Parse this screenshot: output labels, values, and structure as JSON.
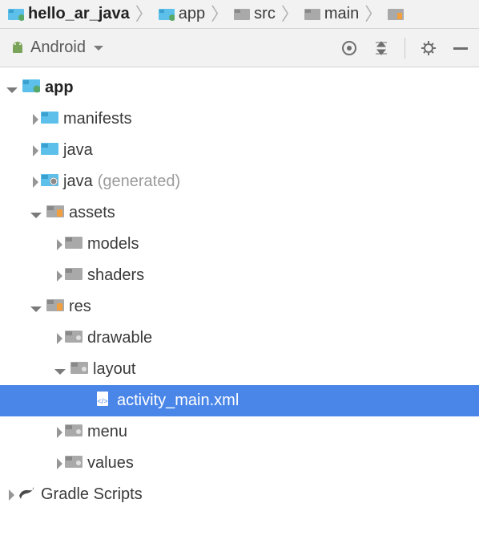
{
  "breadcrumb": {
    "items": [
      {
        "label": "hello_ar_java"
      },
      {
        "label": "app"
      },
      {
        "label": "src"
      },
      {
        "label": "main"
      }
    ]
  },
  "toolbar": {
    "view_label": "Android"
  },
  "tree": {
    "items": [
      {
        "label": "app",
        "depth": 0,
        "arrow": "expanded",
        "icon": "module",
        "bold": true
      },
      {
        "label": "manifests",
        "depth": 1,
        "arrow": "collapsed",
        "icon": "folder-blue"
      },
      {
        "label": "java",
        "depth": 1,
        "arrow": "collapsed",
        "icon": "folder-blue"
      },
      {
        "label": "java",
        "suffix": "(generated)",
        "depth": 1,
        "arrow": "collapsed",
        "icon": "folder-gen"
      },
      {
        "label": "assets",
        "depth": 1,
        "arrow": "expanded",
        "icon": "folder-yellow"
      },
      {
        "label": "models",
        "depth": 2,
        "arrow": "collapsed",
        "icon": "folder-grey"
      },
      {
        "label": "shaders",
        "depth": 2,
        "arrow": "collapsed",
        "icon": "folder-grey"
      },
      {
        "label": "res",
        "depth": 1,
        "arrow": "expanded",
        "icon": "folder-yellow"
      },
      {
        "label": "drawable",
        "depth": 2,
        "arrow": "collapsed",
        "icon": "folder-res"
      },
      {
        "label": "layout",
        "depth": 2,
        "arrow": "expanded",
        "icon": "folder-res"
      },
      {
        "label": "activity_main.xml",
        "depth": 3,
        "arrow": "none",
        "icon": "xml",
        "selected": true
      },
      {
        "label": "menu",
        "depth": 2,
        "arrow": "collapsed",
        "icon": "folder-res"
      },
      {
        "label": "values",
        "depth": 2,
        "arrow": "collapsed",
        "icon": "folder-res"
      },
      {
        "label": "Gradle Scripts",
        "depth": 0,
        "arrow": "collapsed",
        "icon": "gradle"
      }
    ]
  }
}
